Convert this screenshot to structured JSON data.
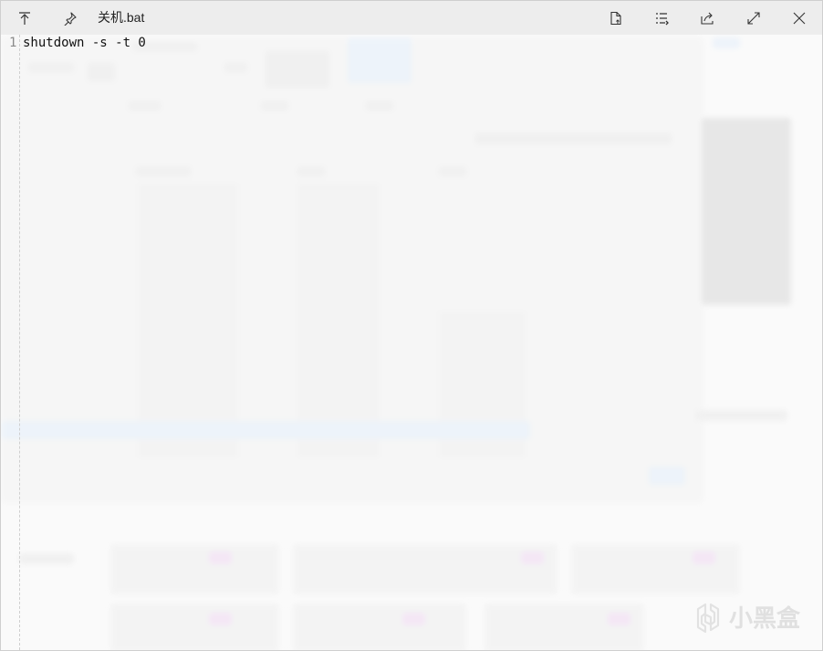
{
  "window": {
    "title": "关机.bat",
    "toolbar": {
      "left": [
        {
          "name": "pin-to-top-icon",
          "label": "Pin to top"
        },
        {
          "name": "pin-icon",
          "label": "Pin"
        }
      ],
      "right": [
        {
          "name": "new-file-icon",
          "label": "Export file"
        },
        {
          "name": "list-icon",
          "label": "List"
        },
        {
          "name": "share-icon",
          "label": "Share"
        },
        {
          "name": "maximize-icon",
          "label": "Maximize"
        },
        {
          "name": "close-icon",
          "label": "Close"
        }
      ]
    }
  },
  "editor": {
    "lines": [
      {
        "number": "1",
        "text": "shutdown -s -t 0"
      }
    ]
  },
  "watermark": {
    "text": "小黑盒"
  }
}
